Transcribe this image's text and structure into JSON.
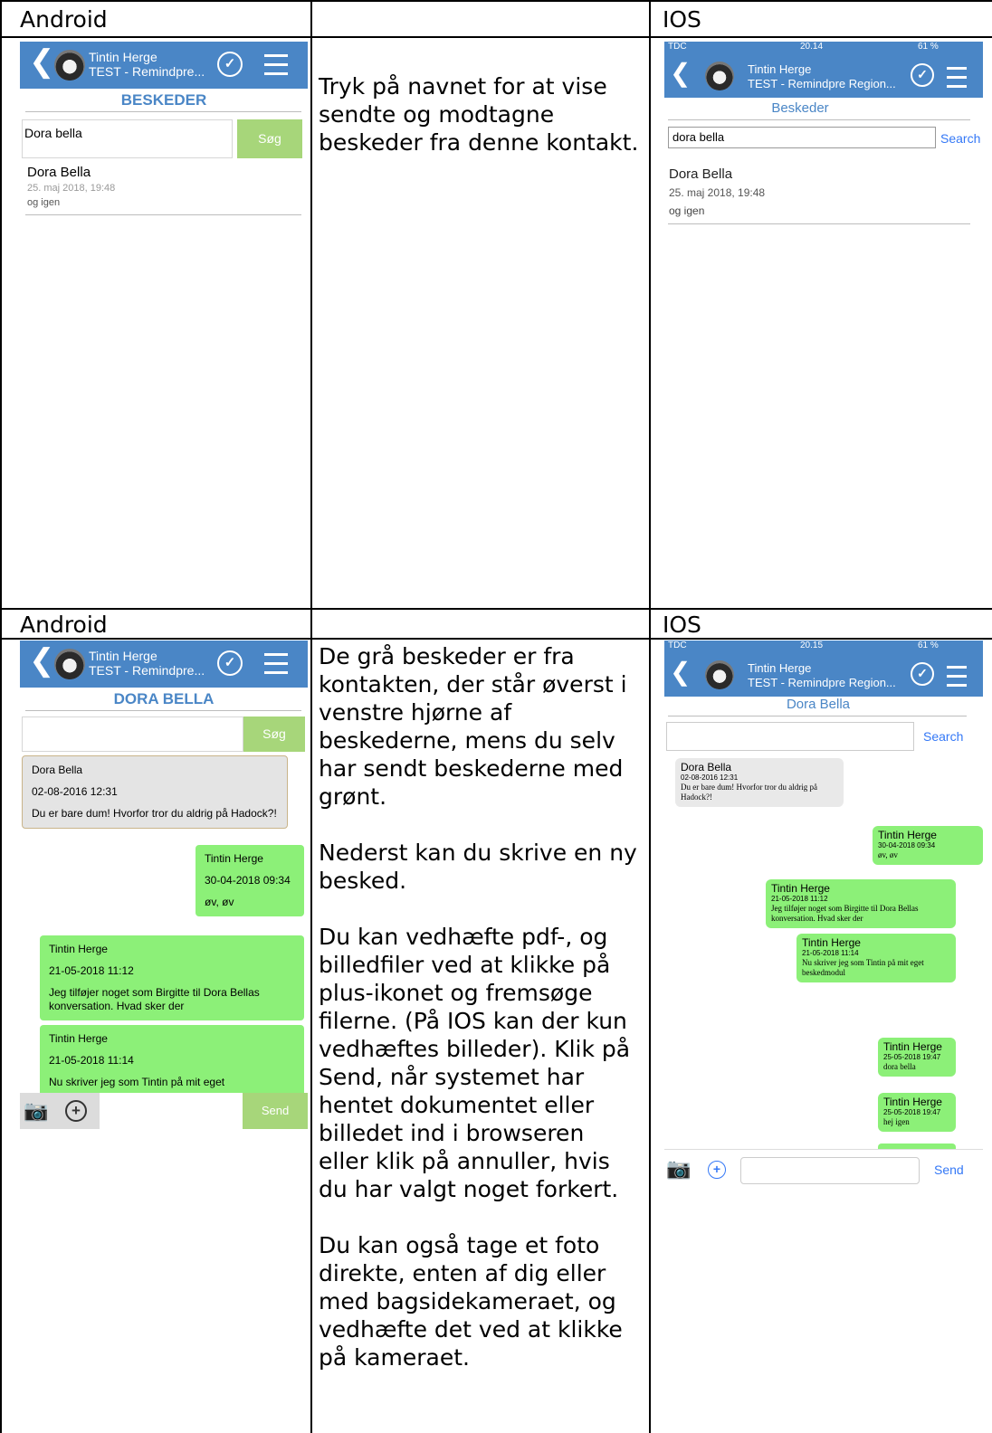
{
  "table": {
    "row1": {
      "left_header": "Android",
      "right_header": "IOS",
      "instruction": "Tryk på navnet for at vise sendte og modtagne beskeder fra denne kontakt."
    },
    "row2": {
      "left_header": "Android",
      "right_header": "IOS",
      "instruction": "De grå beskeder er fra kontakten, der står øverst i venstre hjørne af beskederne, mens du selv har sendt beskederne med grønt.\n\nNederst kan du skrive en ny besked.\n\nDu kan vedhæfte pdf-, og billedfiler ved at klikke på plus-ikonet og fremsøge filerne. (På IOS kan der kun vedhæftes billeder). Klik på Send, når systemet har hentet dokumentet eller billedet ind i browseren eller klik på annuller, hvis du har valgt noget forkert.\n\nDu kan også tage et foto direkte, enten af dig eller med bagsidekameraet, og vedhæfte det ved at klikke på kameraet."
    }
  },
  "android1": {
    "user_name": "Tintin Herge",
    "user_sub": "TEST - Remindpre...",
    "title": "BESKEDER",
    "search_value": "Dora bella",
    "search_button": "Søg",
    "result": {
      "name": "Dora Bella",
      "date": "25. maj 2018, 19:48",
      "message": "og igen"
    }
  },
  "ios1": {
    "status": {
      "carrier": "TDC",
      "time": "20.14",
      "battery": "61 %"
    },
    "user_name": "Tintin Herge",
    "user_sub": "TEST - Remindpre Region...",
    "title": "Beskeder",
    "search_value": "dora bella",
    "search_button": "Search",
    "result": {
      "name": "Dora Bella",
      "date": "25. maj 2018, 19:48",
      "message": "og igen"
    }
  },
  "android2": {
    "user_name": "Tintin Herge",
    "user_sub": "TEST - Remindpre...",
    "title": "DORA BELLA",
    "search_button": "Søg",
    "messages": [
      {
        "name": "Dora Bella",
        "date": "02-08-2016 12:31",
        "text": "Du er bare dum! Hvorfor tror du aldrig på Hadock?!"
      },
      {
        "name": "Tintin Herge",
        "date": "30-04-2018 09:34",
        "text": "øv, øv"
      },
      {
        "name": "Tintin Herge",
        "date": "21-05-2018 11:12",
        "text": "Jeg tilføjer noget som Birgitte til Dora Bellas konversation. Hvad sker der"
      },
      {
        "name": "Tintin Herge",
        "date": "21-05-2018 11:14",
        "text": "Nu skriver jeg som Tintin på mit eget"
      }
    ],
    "send_button": "Send"
  },
  "ios2": {
    "status": {
      "carrier": "TDC",
      "time": "20.15",
      "battery": "61 %"
    },
    "user_name": "Tintin Herge",
    "user_sub": "TEST - Remindpre Region...",
    "title": "Dora Bella",
    "search_button": "Search",
    "messages": [
      {
        "name": "Dora Bella",
        "date": "02-08-2016 12:31",
        "text": "Du er bare dum! Hvorfor tror du aldrig på Hadock?!"
      },
      {
        "name": "Tintin Herge",
        "date": "30-04-2018 09:34",
        "text": "øv, øv"
      },
      {
        "name": "Tintin Herge",
        "date": "21-05-2018 11:12",
        "text": "Jeg tilføjer noget som Birgitte til Dora Bellas konversation. Hvad sker der"
      },
      {
        "name": "Tintin Herge",
        "date": "21-05-2018 11:14",
        "text": "Nu skriver jeg som Tintin på mit eget beskedmodul"
      },
      {
        "name": "Tintin Herge",
        "date": "25-05-2018 19:47",
        "text": "dora bella"
      },
      {
        "name": "Tintin Herge",
        "date": "25-05-2018 19:47",
        "text": "hej igen"
      }
    ],
    "send_button": "Send"
  },
  "colors": {
    "primary": "#4a86c6",
    "green_button": "#a7d67a",
    "green_bubble": "#8cf078",
    "grey_bubble": "#e4e4e4",
    "ios_link": "#3478f6"
  }
}
